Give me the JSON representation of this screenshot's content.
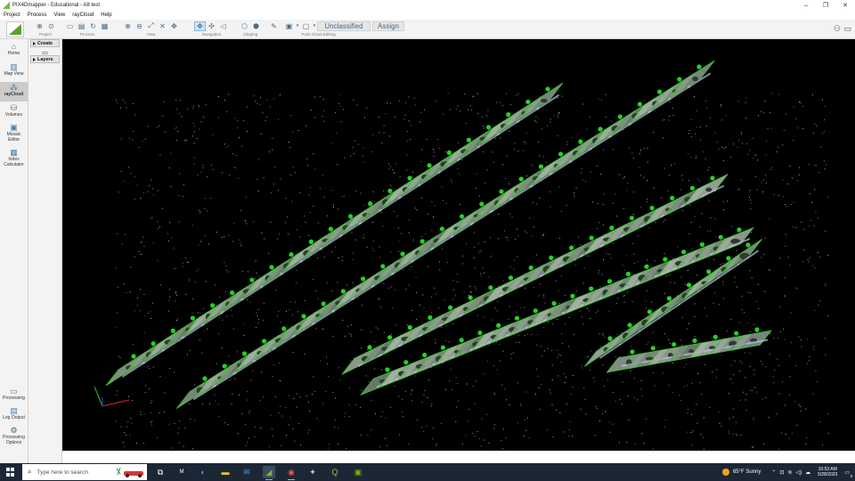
{
  "window": {
    "title": "PIX4Dmapper - Educational - A8 test",
    "controls": {
      "minimize": "–",
      "restore": "❐",
      "close": "✕"
    }
  },
  "menu": [
    "Project",
    "Process",
    "View",
    "rayCloud",
    "Help"
  ],
  "toolbar": {
    "groups": {
      "project": "Project",
      "process": "Process",
      "view": "View",
      "navigation": "Navigation",
      "clipping": "Clipping",
      "editing": "Point Cloud Editing"
    },
    "class_select": "Unclassified",
    "assign": "Assign"
  },
  "sidebar": {
    "items": [
      "Home",
      "Map View",
      "rayCloud",
      "Volumes",
      "Mosaic Editor",
      "Index Calculator"
    ],
    "active": "rayCloud",
    "bottom": [
      "Processing",
      "Log Output",
      "Processing Options"
    ]
  },
  "panel": {
    "create": "Create",
    "layers": "Layers"
  },
  "taskbar": {
    "search_placeholder": "Type here to search",
    "weather": "65°F  Sunny",
    "time": "10:53 AM",
    "date": "5/28/2023",
    "notifications": "3"
  },
  "colors": {
    "accent": "#6fbf3a",
    "camera_frame": "#36c82a",
    "camera_center": "#28d028",
    "viewport_bg": "#000000"
  }
}
